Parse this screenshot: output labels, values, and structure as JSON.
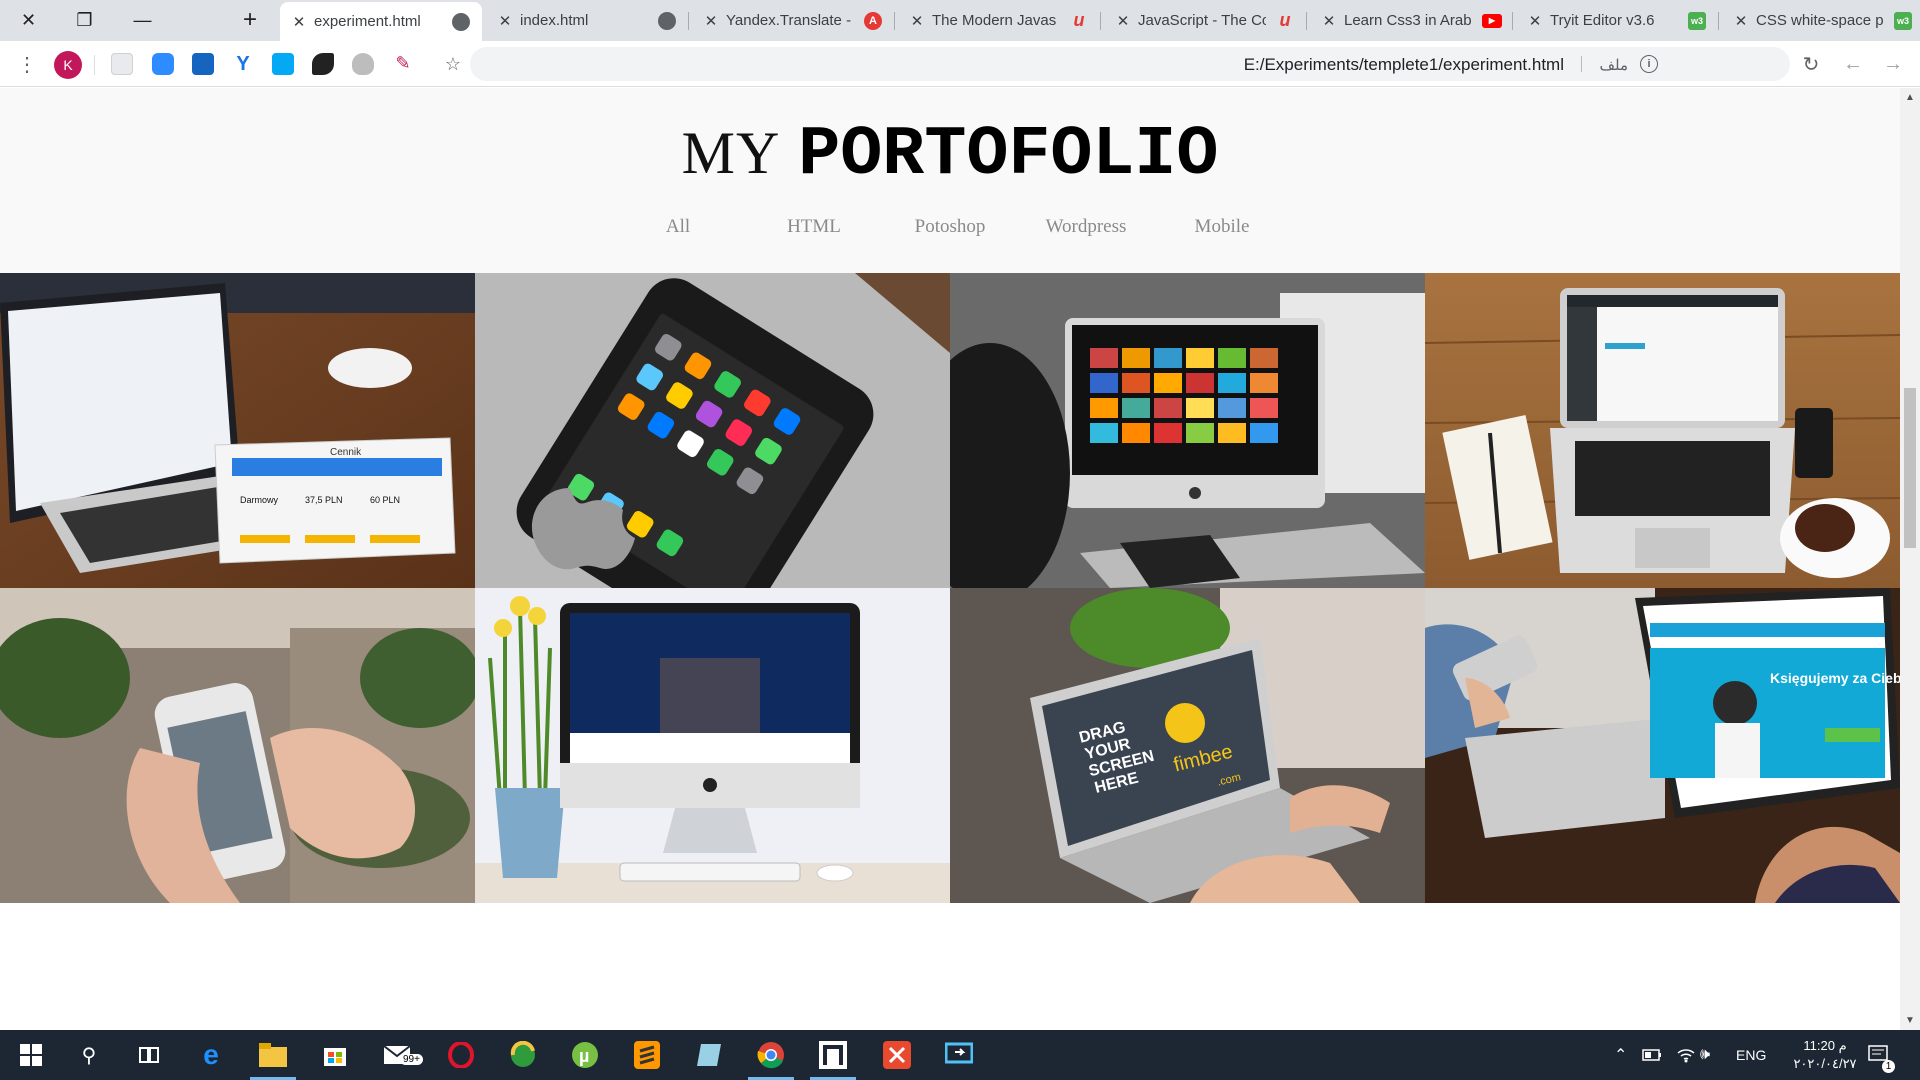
{
  "browser": {
    "tabs": [
      {
        "label": "experiment.html",
        "active": true
      },
      {
        "label": "index.html",
        "active": false
      },
      {
        "label": "Yandex.Translate -",
        "active": false
      },
      {
        "label": "The Modern Javas",
        "active": false
      },
      {
        "label": "JavaScript - The Co",
        "active": false
      },
      {
        "label": "Learn Css3 in Arab",
        "active": false
      },
      {
        "label": "Tryit Editor v3.6",
        "active": false
      },
      {
        "label": "CSS white-space p",
        "active": false
      }
    ],
    "address": {
      "url": "E:/Experiments/templete1/experiment.html",
      "scheme_label": "ملف"
    },
    "profile_initial": "K"
  },
  "page": {
    "title_part1": "MY",
    "title_part2": "PORTOFOLIO",
    "nav": [
      "All",
      "HTML",
      "Potoshop",
      "Wordpress",
      "Mobile"
    ],
    "gallery": [
      {
        "name": "laptop-and-tablet"
      },
      {
        "name": "iphone-on-macbook"
      },
      {
        "name": "person-at-imac"
      },
      {
        "name": "laptop-on-desk-with-coffee"
      },
      {
        "name": "hands-holding-phone"
      },
      {
        "name": "imac-with-flowers"
      },
      {
        "name": "macbook-drag-your-screen"
      },
      {
        "name": "laptop-and-phone-website"
      }
    ],
    "gallery_text": {
      "drag_line1": "DRAG",
      "drag_line2": "YOUR",
      "drag_line3": "SCREEN",
      "drag_line4": "HERE",
      "brand": "fimbee",
      "brand_sub": ".com",
      "pricing_title": "Cennik",
      "price_free": "Darmowy",
      "price_mid": "37,5 PLN",
      "price_high": "60 PLN",
      "web_headline": "Księgujemy za Ciebie bezproblemowo"
    }
  },
  "taskbar": {
    "mail_badge": "99+",
    "language": "ENG",
    "time": "11:20 م",
    "date": "٢٠٢٠/٠٤/٢٧",
    "notification_count": "1"
  }
}
